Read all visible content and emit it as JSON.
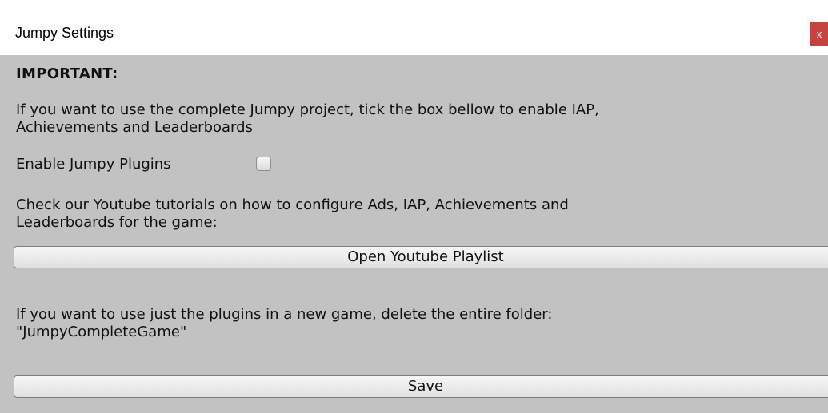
{
  "window": {
    "title": "Jumpy Settings",
    "close_label": "x",
    "close_color": "#c7423d"
  },
  "content": {
    "heading": "IMPORTANT:",
    "intro_line1": "If you want to use the complete Jumpy project, tick the box bellow to enable IAP,",
    "intro_line2": "Achievements and Leaderboards",
    "plugins_label": "Enable Jumpy Plugins",
    "plugins_enabled": false,
    "tutorial_line1": "Check our Youtube tutorials on how to configure Ads, IAP, Achievements and",
    "tutorial_line2": "Leaderboards for the game:",
    "playlist_button_label": "Open Youtube Playlist",
    "delete_line1": "If you want to use just the plugins in a new game, delete the entire folder:",
    "delete_line2": "\"JumpyCompleteGame\"",
    "save_button_label": "Save",
    "background_color": "#c2c2c2"
  }
}
